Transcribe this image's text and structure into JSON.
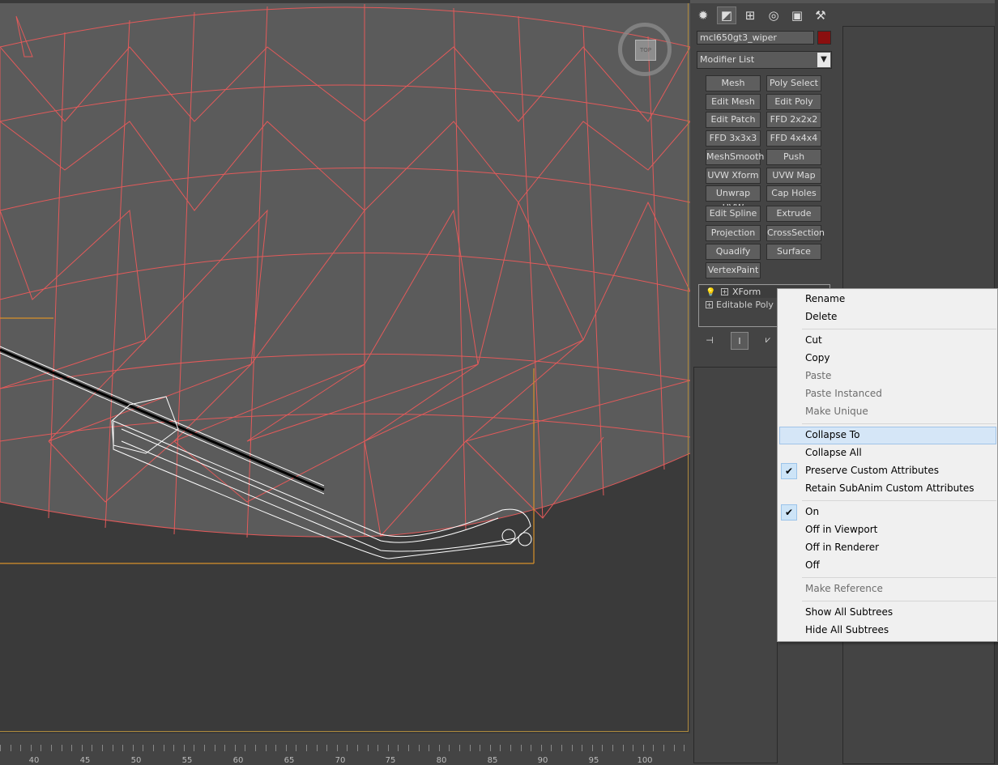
{
  "viewport": {
    "viewcube_label": "TOP",
    "ruler_labels": [
      "40",
      "45",
      "50",
      "55",
      "60",
      "65",
      "70",
      "75",
      "80",
      "85",
      "90",
      "95",
      "100"
    ]
  },
  "command_panel": {
    "tab_icons": [
      "create-icon",
      "modify-icon",
      "hierarchy-icon",
      "motion-icon",
      "display-icon",
      "utilities-icon"
    ],
    "object_name": "mcl650gt3_wiper",
    "object_color": "#8b0f0f",
    "modifier_list_label": "Modifier List",
    "modifier_buttons": [
      [
        "Mesh Select",
        "Poly Select"
      ],
      [
        "Edit Mesh",
        "Edit Poly"
      ],
      [
        "Edit Patch",
        "FFD 2x2x2"
      ],
      [
        "FFD 3x3x3",
        "FFD 4x4x4"
      ],
      [
        "MeshSmooth",
        "Push"
      ],
      [
        "UVW Xform",
        "UVW Map"
      ],
      [
        "Unwrap UVW",
        "Cap Holes"
      ],
      [
        "Edit Spline",
        "Extrude"
      ],
      [
        "Projection",
        "CrossSection"
      ],
      [
        "Quadify Mesh",
        "Surface"
      ],
      [
        "VertexPaint"
      ]
    ],
    "stack": {
      "items": [
        "XForm",
        "Editable Poly"
      ]
    }
  },
  "context_menu": {
    "items": {
      "rename": "Rename",
      "delete": "Delete",
      "cut": "Cut",
      "copy": "Copy",
      "paste": "Paste",
      "paste_instanced": "Paste Instanced",
      "make_unique": "Make Unique",
      "collapse_to": "Collapse To",
      "collapse_all": "Collapse All",
      "preserve_custom_attributes": "Preserve Custom Attributes",
      "retain_subanim": "Retain SubAnim Custom Attributes",
      "on": "On",
      "off_in_viewport": "Off in Viewport",
      "off_in_renderer": "Off in Renderer",
      "off": "Off",
      "make_reference": "Make Reference",
      "show_all_subtrees": "Show All Subtrees",
      "hide_all_subtrees": "Hide All Subtrees"
    },
    "checked": [
      "preserve_custom_attributes",
      "on"
    ],
    "highlighted": "collapse_to"
  }
}
